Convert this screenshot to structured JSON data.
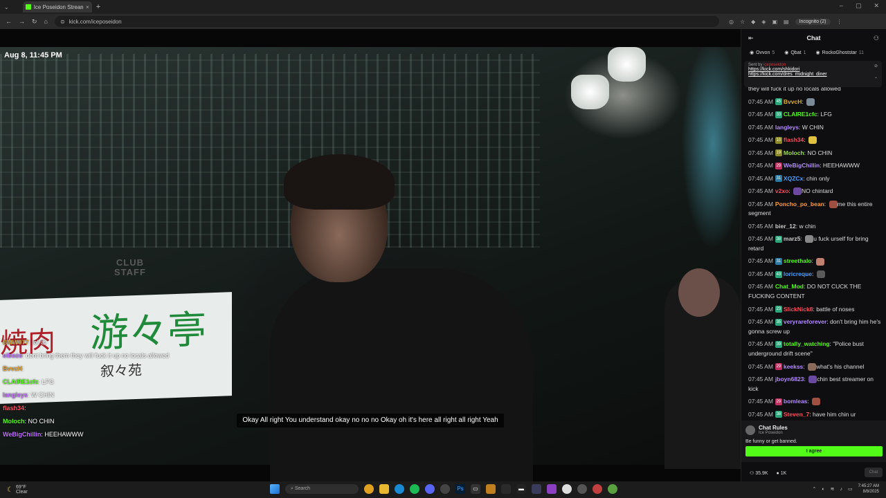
{
  "browser": {
    "tab_title": "Ice Poseidon Stream - Wat",
    "tab_close": "×",
    "new_tab": "+",
    "url": "kick.com/iceposeidon",
    "incognito": "Incognito (2)",
    "nav": {
      "back": "←",
      "forward": "→",
      "reload": "↻",
      "home": "⌂"
    },
    "window_controls": {
      "minimize": "–",
      "maximize": "▢",
      "close": "✕"
    }
  },
  "video": {
    "timestamp": "Aug 8, 11:45 PM",
    "caption": "Okay All right You understand okay no no no Okay oh it's here all right all right Yeah",
    "sign_text_1": "焼肉",
    "sign_text_2": "游々亭",
    "sign_text_3": "叙々苑",
    "shirt_text_1": "CLUB",
    "shirt_text_2": "STAFF",
    "overlay_chat": [
      {
        "user": "BMW077",
        "color": "#e0a030",
        "text": "lol 😐"
      },
      {
        "user": "eibozo",
        "color": "#c070ff",
        "text": "dont bring them they will fuck it up no locals allowed"
      },
      {
        "user": "BvvcH",
        "color": "#e0a030",
        "text": ""
      },
      {
        "user": "CLAIRE1cfc",
        "color": "#53fc18",
        "text": "LFG"
      },
      {
        "user": "langleys",
        "color": "#c070ff",
        "text": "W CHIN"
      },
      {
        "user": "flash34",
        "color": "#ff5060",
        "text": ""
      },
      {
        "user": "Moloch",
        "color": "#53fc18",
        "text": "NO CHIN"
      },
      {
        "user": "WeBigChillin",
        "color": "#c070ff",
        "text": "HEEHAWWW"
      }
    ]
  },
  "chat": {
    "title": "Chat",
    "gifters": [
      {
        "name": "Ovvon",
        "count": "5"
      },
      {
        "name": "Qbat",
        "count": "1"
      },
      {
        "name": "RockoGhoststar",
        "count": "11"
      }
    ],
    "pinned": {
      "sent_by": "Sent by",
      "user": "iceposeidon",
      "link1": "https://kick.com/shkidori",
      "link2": "https://kick.com/dres_midnight_diner"
    },
    "partial_top": "they will fuck it up no locals allowed",
    "messages": [
      {
        "time": "07:45 AM",
        "badge": "45",
        "badge_color": "#2aa67a",
        "user": "BvvcH",
        "color": "#e0b030",
        "text": "",
        "emote": "#7a8a99"
      },
      {
        "time": "07:45 AM",
        "badge": "33",
        "badge_color": "#2aa67a",
        "user": "CLAIRE1cfc",
        "color": "#53fc18",
        "text": "LFG",
        "emote": ""
      },
      {
        "time": "07:45 AM",
        "badge": "",
        "badge_color": "",
        "user": "langleys",
        "color": "#b38cff",
        "text": "W CHIN",
        "emote": ""
      },
      {
        "time": "07:45 AM",
        "badge": "10",
        "badge_color": "#8a8a2a",
        "user": "flash34",
        "color": "#ff4a5a",
        "text": "",
        "emote": "#e0c040"
      },
      {
        "time": "07:45 AM",
        "badge": "19",
        "badge_color": "#8a8a2a",
        "user": "Moloch",
        "color": "#9adf4a",
        "text": "NO CHIN",
        "emote": ""
      },
      {
        "time": "07:45 AM",
        "badge": "29",
        "badge_color": "#c03060",
        "user": "WeBigChillin",
        "color": "#b38cff",
        "text": "HEEHAWWW",
        "emote": ""
      },
      {
        "time": "07:45 AM",
        "badge": "31",
        "badge_color": "#2a7aa6",
        "user": "XQZCx",
        "color": "#4aa0ff",
        "text": "chin only",
        "emote": ""
      },
      {
        "time": "07:45 AM",
        "badge": "",
        "badge_color": "",
        "user": "v2xo",
        "color": "#ff4a5a",
        "text": "NO chintard",
        "emote": "#6a4aa0"
      },
      {
        "time": "07:45 AM",
        "badge": "",
        "badge_color": "",
        "user": "Poncho_po_bean",
        "color": "#ff9a3a",
        "text": "me this entire segment",
        "emote": "#a05040"
      },
      {
        "time": "07:45 AM",
        "badge": "",
        "badge_color": "",
        "user": "bier_12",
        "color": "#cccccc",
        "text": "w chin",
        "emote": ""
      },
      {
        "time": "07:45 AM",
        "badge": "38",
        "badge_color": "#2aa67a",
        "user": "marz5",
        "color": "#cccccc",
        "text": "u fuck urself for bring retard",
        "emote": "#888888"
      },
      {
        "time": "07:45 AM",
        "badge": "31",
        "badge_color": "#2a7aa6",
        "user": "streethalo",
        "color": "#53fc18",
        "text": "",
        "emote": "#c08070"
      },
      {
        "time": "07:45 AM",
        "badge": "43",
        "badge_color": "#2aa67a",
        "user": "loricreque",
        "color": "#4aa0ff",
        "text": "",
        "emote": "#5a5a5a"
      },
      {
        "time": "07:45 AM",
        "badge": "",
        "badge_color": "",
        "user": "Chat_Mod",
        "color": "#53fc18",
        "text": "DO NOT CUCK THE FUCKING CONTENT",
        "emote": ""
      },
      {
        "time": "07:45 AM",
        "badge": "23",
        "badge_color": "#2aa67a",
        "user": "SlickNick8",
        "color": "#ff4a5a",
        "text": "battle of noses",
        "emote": ""
      },
      {
        "time": "07:45 AM",
        "badge": "35",
        "badge_color": "#2aa67a",
        "user": "veryrareforever",
        "color": "#b38cff",
        "text": "don't bring him he's gonna screw up",
        "emote": ""
      },
      {
        "time": "07:45 AM",
        "badge": "39",
        "badge_color": "#2aa67a",
        "user": "totally_watching",
        "color": "#53fc18",
        "text": "\"Police bust underground drift scene\"",
        "emote": ""
      },
      {
        "time": "07:45 AM",
        "badge": "29",
        "badge_color": "#c03060",
        "user": "keekss",
        "color": "#b38cff",
        "text": "what's his channel",
        "emote": "#8a6a5a"
      },
      {
        "time": "07:45 AM",
        "badge": "",
        "badge_color": "",
        "user": "jboyn6823",
        "color": "#b38cff",
        "text": "chin best streamer on kick",
        "emote": "#6a4aa0"
      },
      {
        "time": "07:45 AM",
        "badge": "29",
        "badge_color": "#c03060",
        "user": "bomleas",
        "color": "#b38cff",
        "text": "",
        "emote": "#a05040"
      },
      {
        "time": "07:45 AM",
        "badge": "38",
        "badge_color": "#2aa67a",
        "user": "Steven_7",
        "color": "#ff4a5a",
        "text": "have him chin ur",
        "emote": ""
      }
    ],
    "rules": {
      "title": "Chat Rules",
      "sub": "Ice Poseidon",
      "text": "Be funny or get banned.",
      "agree": "I agree"
    },
    "viewers": "35.9K",
    "likes": "1K",
    "send": "Chat"
  },
  "taskbar": {
    "weather_temp": "69°F",
    "weather_desc": "Clear",
    "search": "Search",
    "time": "7:45:27 AM",
    "date": "8/8/2025"
  }
}
